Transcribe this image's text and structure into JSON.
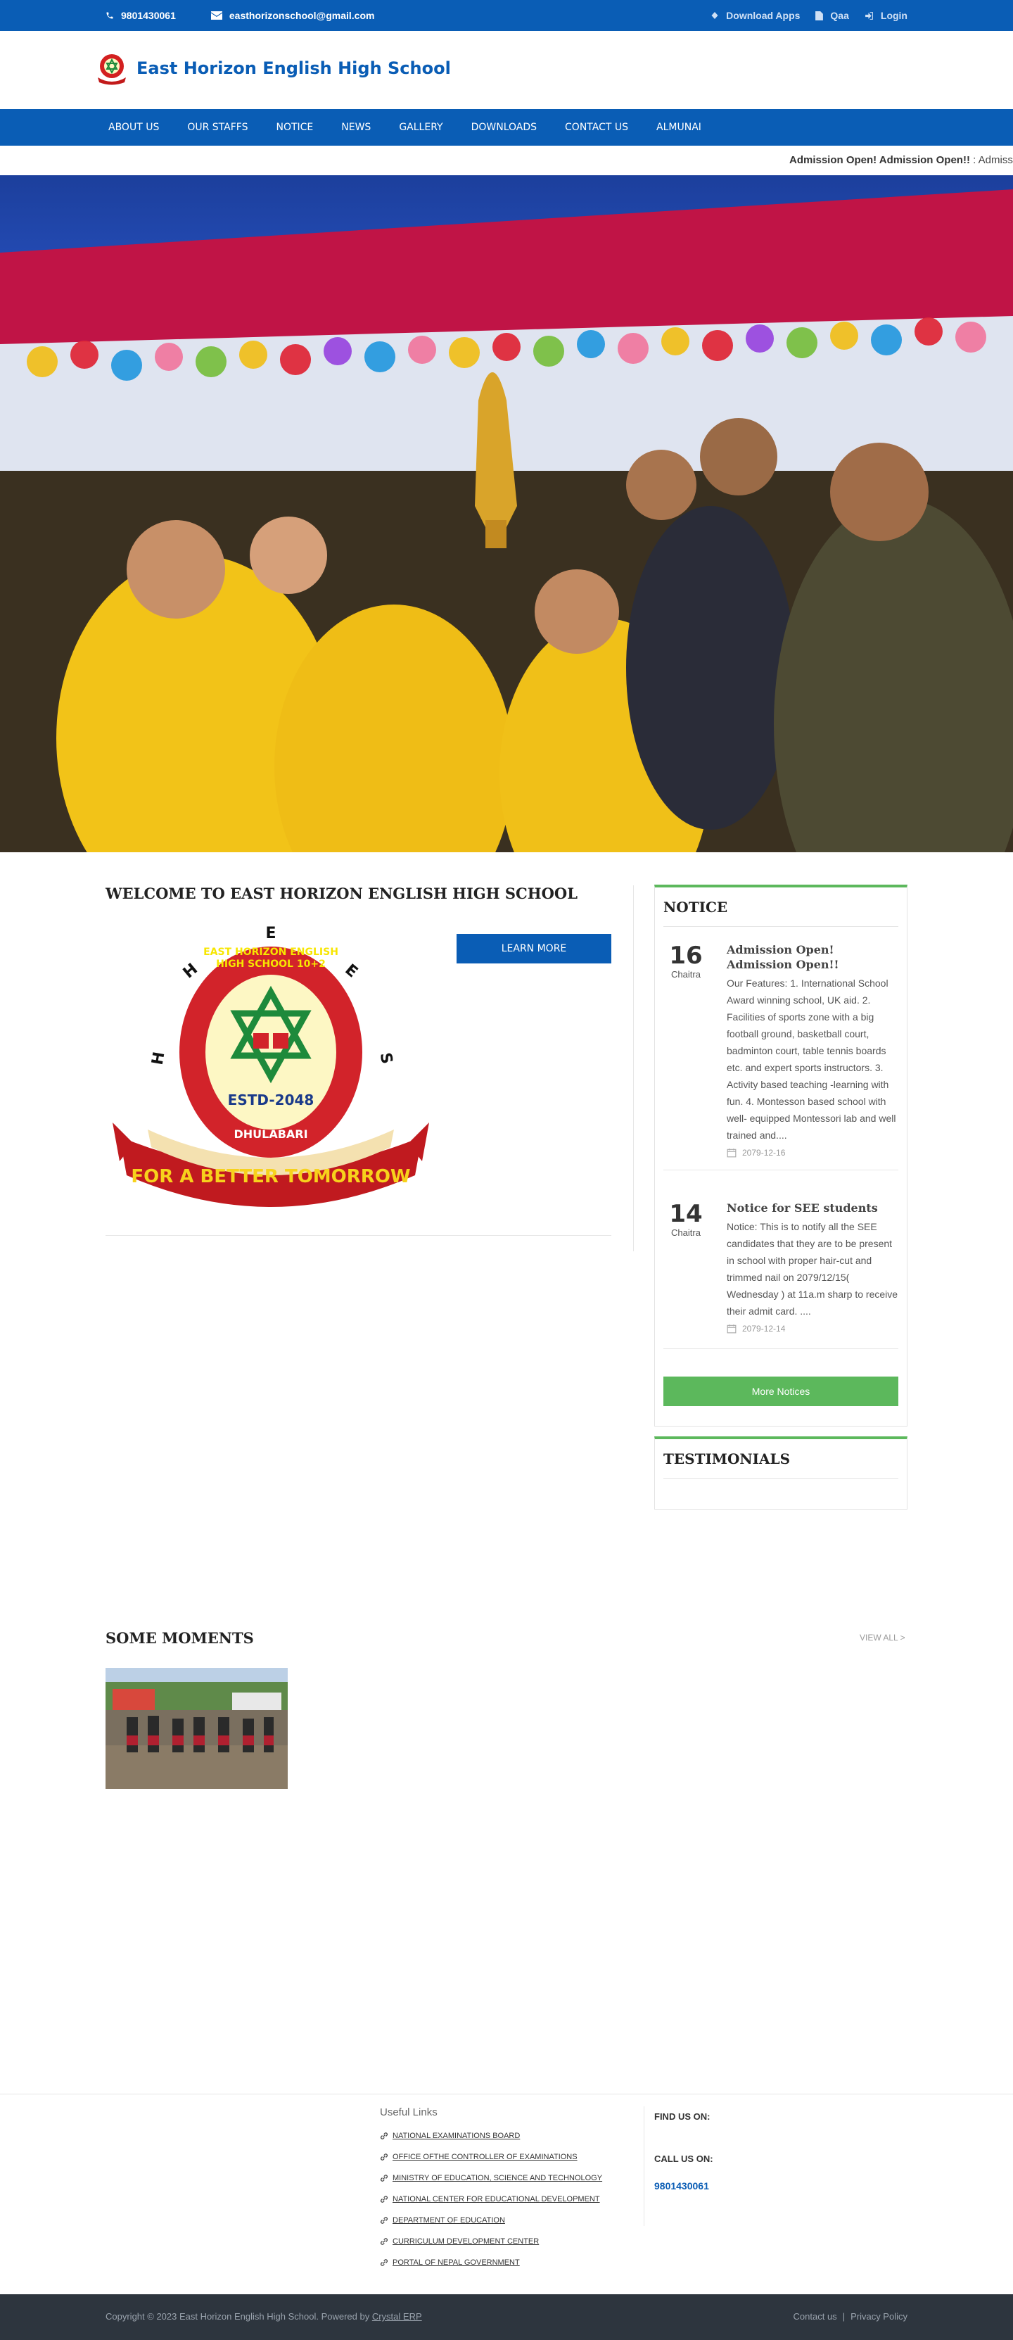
{
  "topbar": {
    "phone": "9801430061",
    "email": "easthorizonschool@gmail.com",
    "download_apps": "Download Apps",
    "qaa": "Qaa",
    "login": "Login"
  },
  "header": {
    "school_name": "East Horizon English High School"
  },
  "nav": {
    "items": [
      "ABOUT US",
      "OUR STAFFS",
      "NOTICE",
      "NEWS",
      "GALLERY",
      "DOWNLOADS",
      "CONTACT US",
      "ALMUNAI"
    ]
  },
  "ticker": {
    "title": "Admission Open! Admission Open!!",
    "rest": " : Admiss"
  },
  "welcome": {
    "title": "WELCOME TO EAST HORIZON ENGLISH HIGH SCHOOL",
    "learn_more": "LEARN MORE",
    "logo": {
      "ring_text": "EAST HORIZON ENGLISH HIGH SCHOOL 10+2",
      "estd": "ESTD-2048",
      "place": "DHULABARI",
      "motto": "FOR A BETTER TOMORROW",
      "letters": [
        "E",
        "H",
        "E",
        "H",
        "S",
        "E"
      ]
    }
  },
  "notice": {
    "title": "NOTICE",
    "items": [
      {
        "day": "16",
        "month": "Chaitra",
        "title": "Admission Open! Admission Open!!",
        "text": "Our Features: 1. International School Award winning school, UK aid. 2. Facilities of sports zone with a big football ground, basketball court, badminton court, table tennis boards etc. and expert sports instructors. 3. Activity based teaching -learning with fun. 4. Montesson based school with well- equipped Montessori lab and well trained and....",
        "date": "2079-12-16"
      },
      {
        "day": "14",
        "month": "Chaitra",
        "title": "Notice for SEE students",
        "text": "Notice: This is to notify all the SEE candidates that they are to be present in school with proper hair-cut and trimmed nail on 2079/12/15( Wednesday ) at 11a.m sharp to receive their admit card. ....",
        "date": "2079-12-14"
      }
    ],
    "more_button": "More Notices"
  },
  "testimonials": {
    "title": "TESTIMONIALS"
  },
  "moments": {
    "title": "SOME MOMENTS",
    "view_all": "VIEW ALL >"
  },
  "footer": {
    "useful_title": "Useful Links",
    "links": [
      "NATIONAL EXAMINATIONS BOARD",
      "OFFICE OFTHE CONTROLLER OF EXAMINATIONS",
      "MINISTRY OF EDUCATION, SCIENCE AND TECHNOLOGY",
      "NATIONAL CENTER FOR EDUCATIONAL DEVELOPMENT",
      "DEPARTMENT OF EDUCATION",
      "CURRICULUM DEVELOPMENT CENTER",
      "PORTAL OF NEPAL GOVERNMENT"
    ],
    "find_us": "FIND US ON:",
    "call_us": "CALL US ON:",
    "phone": "9801430061",
    "copyright": "Copyright © 2023 East Horizon English High School. Powered by ",
    "powered_by": "Crystal ERP",
    "contact": "Contact us",
    "privacy": "Privacy Policy"
  },
  "colors": {
    "primary": "#0a5db5",
    "accent": "#5cb85c",
    "footer": "#2d353e"
  }
}
